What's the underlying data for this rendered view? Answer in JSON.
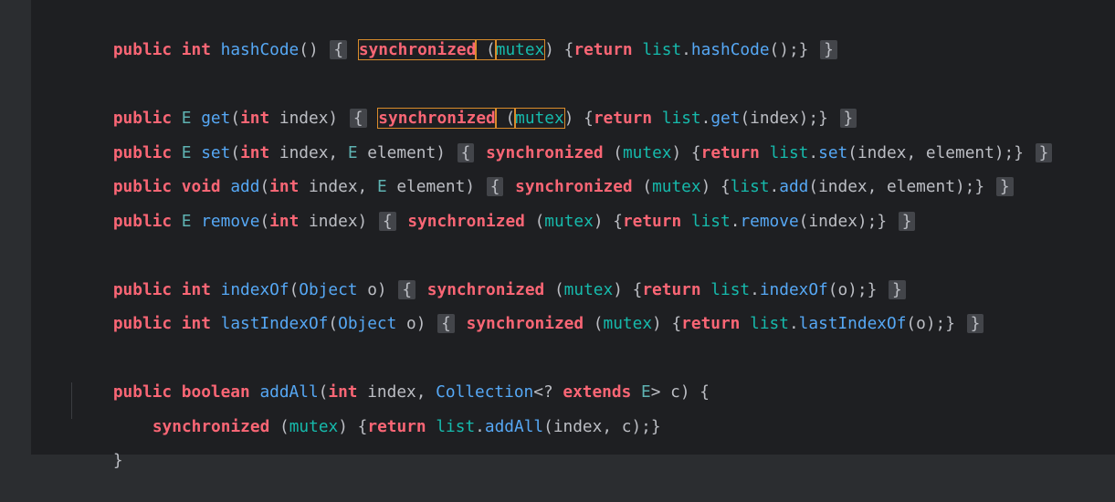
{
  "keywords": {
    "public": "public",
    "int": "int",
    "void": "void",
    "boolean": "boolean",
    "synchronized": "synchronized",
    "return": "return",
    "extends": "extends"
  },
  "lines": [
    {
      "id": "hashcode",
      "parts": [
        "public",
        " ",
        "int",
        " ",
        "hashCode",
        "() ",
        "{",
        " ",
        "synchronized",
        " (",
        "mutex",
        ") {",
        "return",
        " ",
        "list",
        ".",
        "hashCode",
        "();}",
        " ",
        "}"
      ]
    },
    {
      "id": "get",
      "parts": [
        "public",
        " ",
        "E",
        " ",
        "get",
        "(",
        "int",
        " index) ",
        "{",
        " ",
        "synchronized",
        " (",
        "mutex",
        ") {",
        "return",
        " ",
        "list",
        ".",
        "get",
        "(index);}",
        " ",
        "}"
      ]
    },
    {
      "id": "set",
      "parts": [
        "public",
        " ",
        "E",
        " ",
        "set",
        "(",
        "int",
        " index, ",
        "E",
        " element) ",
        "{",
        " ",
        "synchronized",
        " (",
        "mutex",
        ") {",
        "return",
        " ",
        "list",
        ".",
        "set",
        "(index, element);}",
        " ",
        "}"
      ]
    },
    {
      "id": "add",
      "parts": [
        "public",
        " ",
        "void",
        " ",
        "add",
        "(",
        "int",
        " index, ",
        "E",
        " element) ",
        "{",
        " ",
        "synchronized",
        " (",
        "mutex",
        ") {",
        "list",
        ".",
        "add",
        "(index, element);}",
        " ",
        "}"
      ]
    },
    {
      "id": "remove",
      "parts": [
        "public",
        " ",
        "E",
        " ",
        "remove",
        "(",
        "int",
        " index) ",
        "{",
        " ",
        "synchronized",
        " (",
        "mutex",
        ") {",
        "return",
        " ",
        "list",
        ".",
        "remove",
        "(index);}",
        " ",
        "}"
      ]
    },
    {
      "id": "indexof",
      "parts": [
        "public",
        " ",
        "int",
        " ",
        "indexOf",
        "(",
        "Object",
        " o) ",
        "{",
        " ",
        "synchronized",
        " (",
        "mutex",
        ") {",
        "return",
        " ",
        "list",
        ".",
        "indexOf",
        "(o);}",
        " ",
        "}"
      ]
    },
    {
      "id": "lastindexof",
      "parts": [
        "public",
        " ",
        "int",
        " ",
        "lastIndexOf",
        "(",
        "Object",
        " o) ",
        "{",
        " ",
        "synchronized",
        " (",
        "mutex",
        ") {",
        "return",
        " ",
        "list",
        ".",
        "lastIndexOf",
        "(o);}",
        " ",
        "}"
      ]
    },
    {
      "id": "addall",
      "parts": [
        "public",
        " ",
        "boolean",
        " ",
        "addAll",
        "(",
        "int",
        " index, ",
        "Collection",
        "<? ",
        "extends",
        " ",
        "E",
        "> c) {"
      ]
    },
    {
      "id": "addall-body",
      "parts": [
        "synchronized",
        " (",
        "mutex",
        ") {",
        "return",
        " ",
        "list",
        ".",
        "addAll",
        "(index, c);}"
      ]
    },
    {
      "id": "close",
      "parts": [
        "}"
      ]
    }
  ],
  "colors": {
    "background": "#1e1f22",
    "keyword": "#fa6675",
    "method": "#56a8f5",
    "field": "#16baac",
    "type": "#5fb3b3",
    "highlight_box": "#d98b2b",
    "brace_highlight": "#43454a"
  }
}
